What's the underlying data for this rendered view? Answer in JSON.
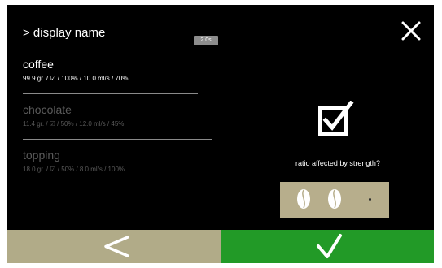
{
  "header": {
    "title": "> display name"
  },
  "products": [
    {
      "name": "coffee",
      "detail": "99.9 gr. / ☑ / 100% / 10.0 ml/s / 70%",
      "active": true
    },
    {
      "name": "chocolate",
      "detail": "11.4 gr. / ☑ / 50% / 12.0 ml/s / 45%",
      "active": false
    },
    {
      "name": "topping",
      "detail": "18.0 gr. / ☑ / 50% / 8.0 ml/s / 100%",
      "active": false
    }
  ],
  "badge": {
    "label": "2.0s"
  },
  "ratio": {
    "label": "ratio affected by strength?",
    "checked": true
  },
  "strength": {
    "level": 2,
    "max": 3
  },
  "colors": {
    "screen": "#000000",
    "back": "#b1ab88",
    "confirm": "#229a27",
    "strength_box": "#b7ae8c"
  },
  "icons": {
    "close": "close-icon",
    "checkbox": "checkbox-checked-icon",
    "back": "chevron-left-icon",
    "confirm": "checkmark-icon",
    "bean": "coffee-bean-icon"
  }
}
